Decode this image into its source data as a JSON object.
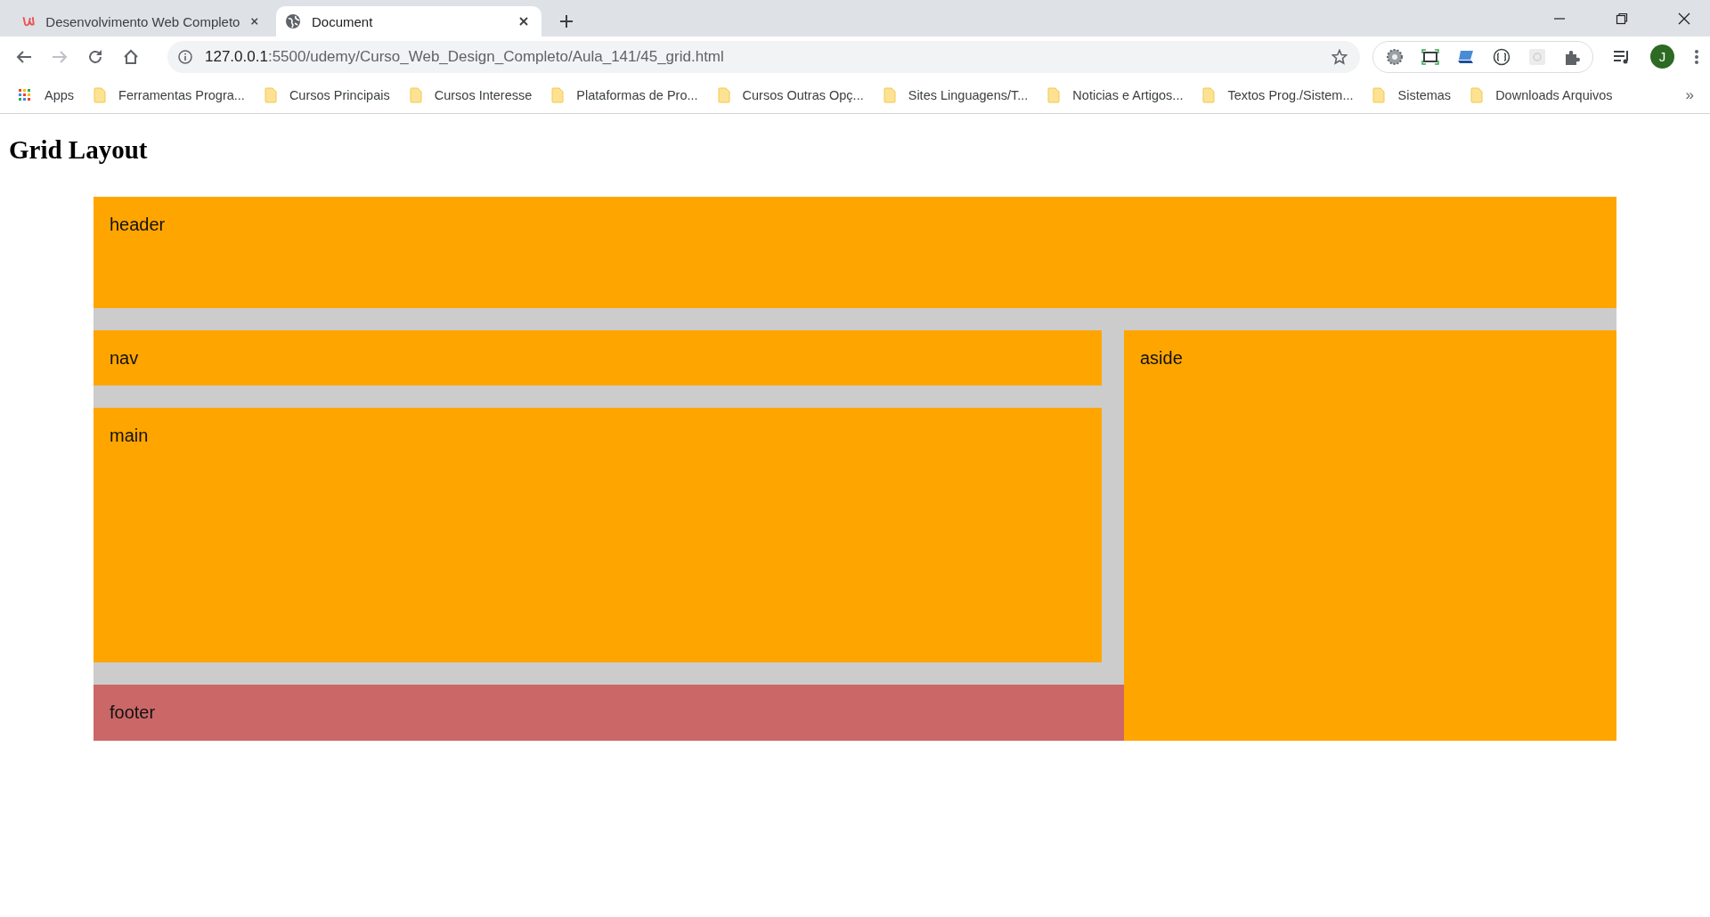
{
  "browser": {
    "tabs": [
      {
        "title": "Desenvolvimento Web Completo",
        "selected": false
      },
      {
        "title": "Document",
        "selected": true
      }
    ],
    "address": {
      "host": "127.0.0.1",
      "path": ":5500/udemy/Curso_Web_Design_Completo/Aula_141/45_grid.html"
    },
    "profile": "J",
    "bookmarks": [
      {
        "label": "Apps",
        "kind": "apps"
      },
      {
        "label": "Ferramentas Progra...",
        "kind": "folder"
      },
      {
        "label": "Cursos Principais",
        "kind": "folder"
      },
      {
        "label": "Cursos Interesse",
        "kind": "folder"
      },
      {
        "label": "Plataformas de Pro...",
        "kind": "folder"
      },
      {
        "label": "Cursos Outras Opç...",
        "kind": "folder"
      },
      {
        "label": "Sites Linguagens/T...",
        "kind": "folder"
      },
      {
        "label": "Noticias e Artigos...",
        "kind": "folder"
      },
      {
        "label": "Textos Prog./Sistem...",
        "kind": "folder"
      },
      {
        "label": "Sistemas",
        "kind": "folder"
      },
      {
        "label": "Downloads Arquivos",
        "kind": "folder"
      }
    ],
    "bookmarks_overflow": "»"
  },
  "page": {
    "heading": "Grid Layout",
    "areas": [
      {
        "label": "header",
        "kind": "header",
        "color": "#ffa500"
      },
      {
        "label": "nav",
        "kind": "nav",
        "color": "#ffa500"
      },
      {
        "label": "aside",
        "kind": "aside",
        "color": "#ffa500"
      },
      {
        "label": "main",
        "kind": "main",
        "color": "#ffa500"
      },
      {
        "label": "footer",
        "kind": "footer",
        "color": "#cb6767"
      }
    ]
  }
}
